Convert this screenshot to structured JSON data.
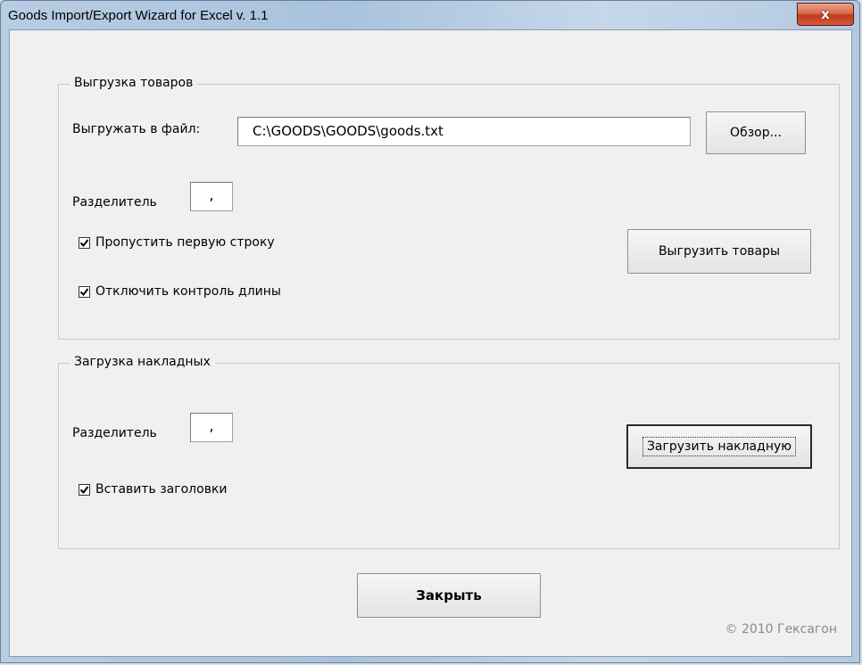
{
  "window": {
    "title": "Goods Import/Export Wizard for Excel v. 1.1",
    "close_label": "x"
  },
  "export_group": {
    "legend": "Выгрузка товаров",
    "file_label": "Выгружать в файл:",
    "file_value": "C:\\GOODS\\GOODS\\goods.txt",
    "browse_label": "Обзор...",
    "separator_label": "Разделитель",
    "separator_value": ",",
    "skip_first_row_label": "Пропустить первую строку",
    "skip_first_row_checked": true,
    "disable_length_check_label": "Отключить контроль длины",
    "disable_length_check_checked": true,
    "export_button_label": "Выгрузить товары"
  },
  "import_group": {
    "legend": "Загрузка накладных",
    "separator_label": "Разделитель",
    "separator_value": ",",
    "insert_headers_label": "Вставить заголовки",
    "insert_headers_checked": true,
    "import_button_label": "Загрузить накладную"
  },
  "footer": {
    "close_button_label": "Закрыть",
    "copyright": "© 2010 Гексагон"
  },
  "colors": {
    "titlebar": "#b7cde4",
    "close_button": "#c3391c",
    "client_background": "#f0f0f0"
  }
}
